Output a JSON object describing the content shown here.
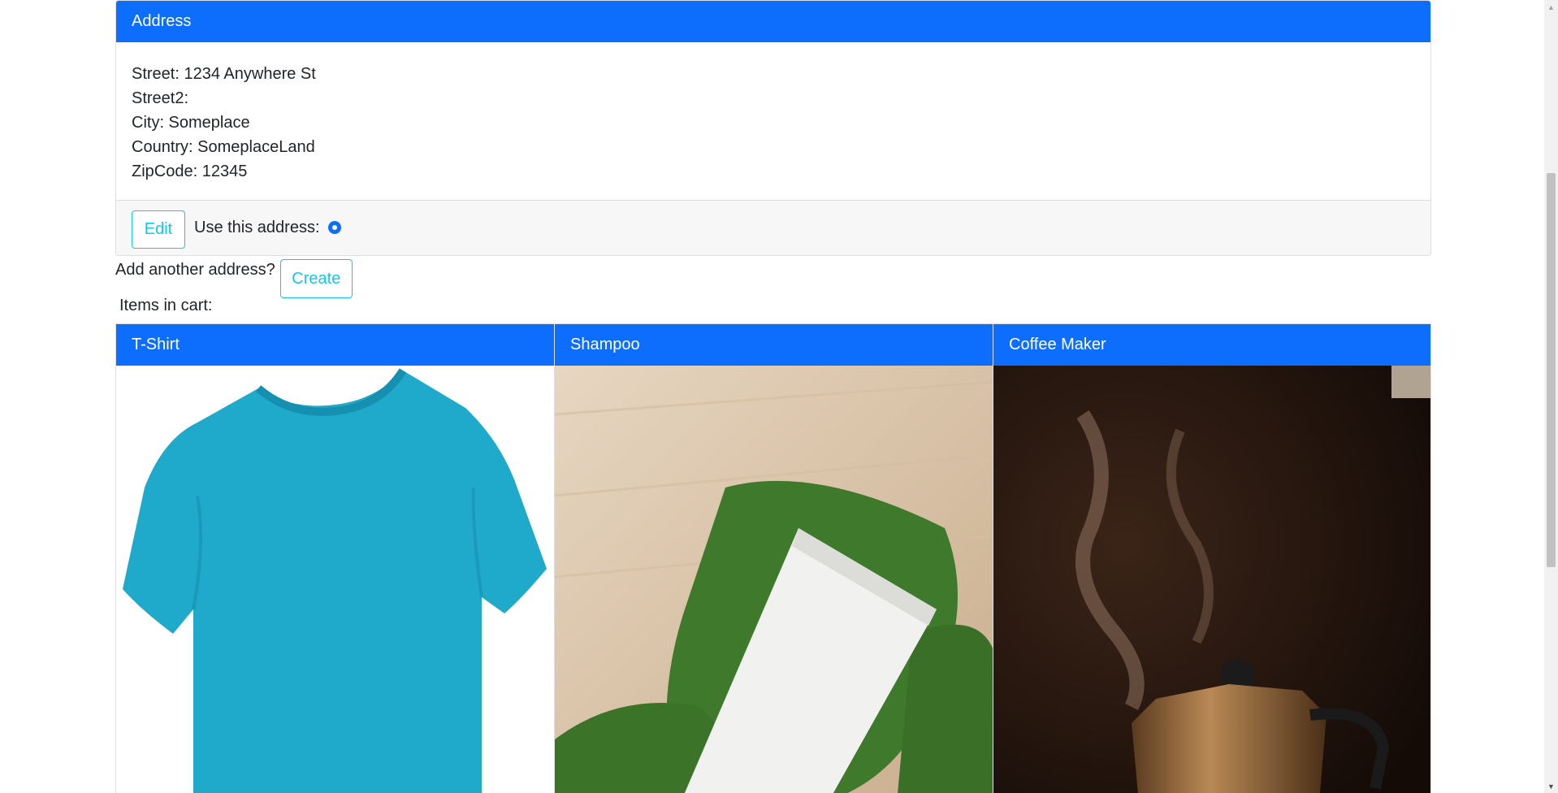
{
  "address_card": {
    "header": "Address",
    "street": "Street: 1234 Anywhere St",
    "street2": "Street2:",
    "city": "City: Someplace",
    "country": "Country: SomeplaceLand",
    "zipcode": "ZipCode: 12345",
    "edit_label": "Edit",
    "use_label": "Use this address:",
    "use_selected": true
  },
  "add_address": {
    "prompt": "Add another address?",
    "create_label": "Create"
  },
  "cart": {
    "label": "Items in cart:",
    "items": [
      {
        "name": "T-Shirt",
        "image": "tshirt-image"
      },
      {
        "name": "Shampoo",
        "image": "shampoo-image"
      },
      {
        "name": "Coffee Maker",
        "image": "coffee-maker-image"
      }
    ]
  },
  "colors": {
    "primary": "#0d6efd",
    "info": "#0dcaf0",
    "footer_bg": "#f7f7f7"
  }
}
